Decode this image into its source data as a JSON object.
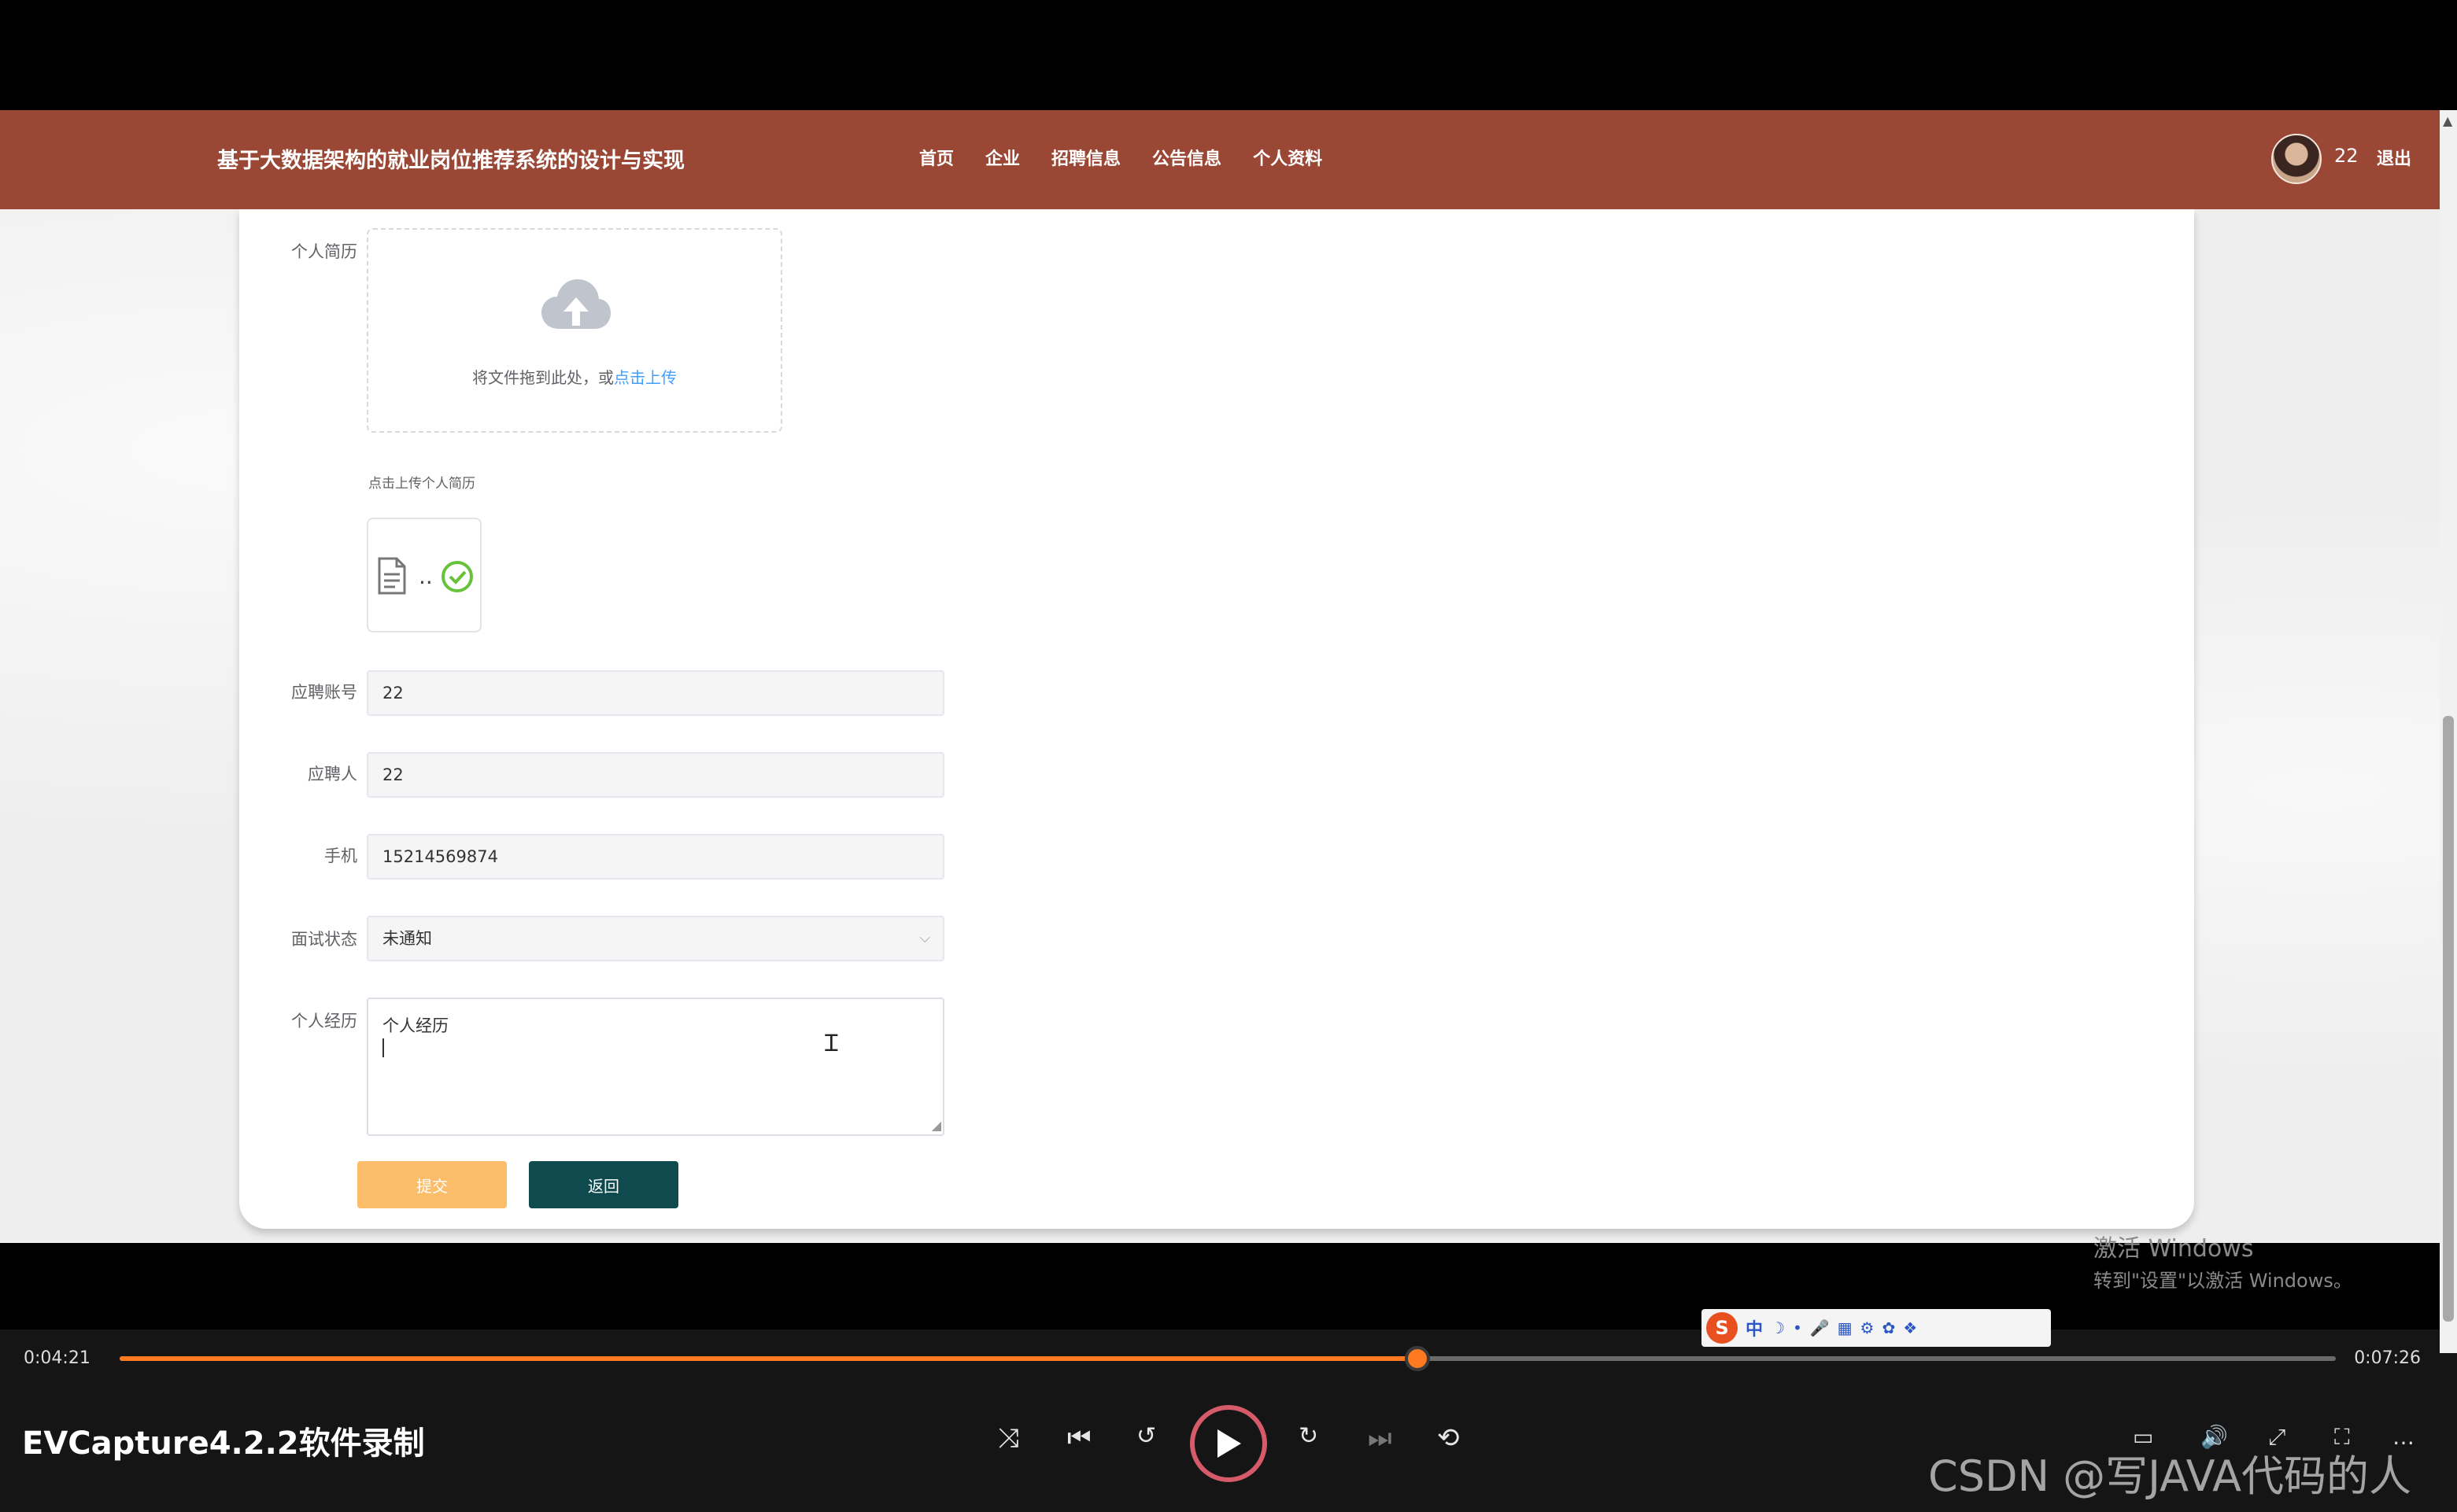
{
  "header": {
    "site_title": "基于大数据架构的就业岗位推荐系统的设计与实现",
    "nav": [
      "首页",
      "企业",
      "招聘信息",
      "公告信息",
      "个人资料"
    ],
    "username": "22",
    "logout": "退出",
    "bg_color": "#9a4835"
  },
  "form": {
    "resume_label": "个人简历",
    "upload_text": "将文件拖到此处，或",
    "upload_link": "点击上传",
    "upload_tip": "点击上传个人简历",
    "file_name": "..",
    "account_label": "应聘账号",
    "account_value": "22",
    "applicant_label": "应聘人",
    "applicant_value": "22",
    "phone_label": "手机",
    "phone_value": "15214569874",
    "status_label": "面试状态",
    "status_value": "未通知",
    "experience_label": "个人经历",
    "experience_value": "个人经历",
    "submit_label": "提交",
    "back_label": "返回"
  },
  "overlay": {
    "activate_title": "激活 Windows",
    "activate_sub": "转到\"设置\"以激活 Windows。",
    "watermark": "CSDN @写JAVA代码的人"
  },
  "player": {
    "current_time": "0:04:21",
    "total_time": "0:07:26",
    "progress": 0.5856,
    "app_label": "EVCapture4.2.2软件录制",
    "accent_color": "#ff7a21"
  },
  "ime": {
    "logo": "S",
    "mode": "中"
  }
}
